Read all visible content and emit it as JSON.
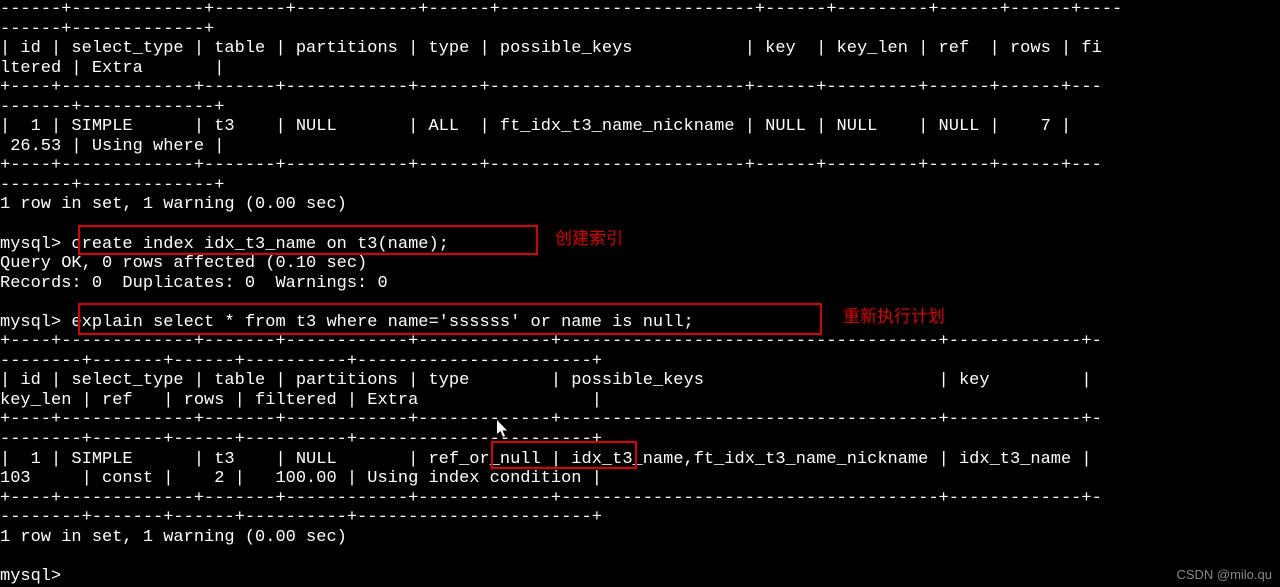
{
  "table1_border1": "------+-------------+-------+------------+------+-------------------------+------+---------+------+------+----",
  "table1_border2": "------+-------------+",
  "table1_header1": "| id | select_type | table | partitions | type | possible_keys           | key  | key_len | ref  | rows | fi",
  "table1_header2": "ltered | Extra       |",
  "table1_sep1": "+----+-------------+-------+------------+------+-------------------------+------+---------+------+------+---",
  "table1_sep2": "-------+-------------+",
  "table1_data1": "|  1 | SIMPLE      | t3    | NULL       | ALL  | ft_idx_t3_name_nickname | NULL | NULL    | NULL |    7 |   ",
  "table1_data2": " 26.53 | Using where |",
  "table1_bot1": "+----+-------------+-------+------------+------+-------------------------+------+---------+------+------+---",
  "table1_bot2": "-------+-------------+",
  "result1": "1 row in set, 1 warning (0.00 sec)",
  "blank": "",
  "prompt1_prefix": "mysql> ",
  "command1": "create index idx_t3_name on t3(name);",
  "query_ok": "Query OK, 0 rows affected (0.10 sec)",
  "records": "Records: 0  Duplicates: 0  Warnings: 0",
  "command2": "explain select * from t3 where name='ssssss' or name is null;",
  "table2_border1": "+----+-------------+-------+------------+-------------+-------------------------------------+-------------+-",
  "table2_border2": "--------+-------+------+----------+-----------------------+",
  "table2_header1": "| id | select_type | table | partitions | type        | possible_keys                       | key         |",
  "table2_header2": "key_len | ref   | rows | filtered | Extra                 |",
  "table2_sep1": "+----+-------------+-------+------------+-------------+-------------------------------------+-------------+-",
  "table2_sep2": "--------+-------+------+----------+-----------------------+",
  "table2_data1a": "|  1 | SIMPLE      | t3    | NULL       | ",
  "table2_data1_highlight": "ref_or_null",
  "table2_data1b": " | idx_t3_name,ft_idx_t3_name_nickname | idx_t3_name |",
  "table2_data2": "103     | const |    2 |   100.00 | Using index condition |",
  "table2_bot1": "+----+-------------+-------+------------+-------------+-------------------------------------+-------------+-",
  "table2_bot2": "--------+-------+------+----------+-----------------------+",
  "result2": "1 row in set, 1 warning (0.00 sec)",
  "prompt_end": "mysql>",
  "label1": "创建索引",
  "label2": "重新执行计划",
  "watermark": "CSDN @milo.qu"
}
